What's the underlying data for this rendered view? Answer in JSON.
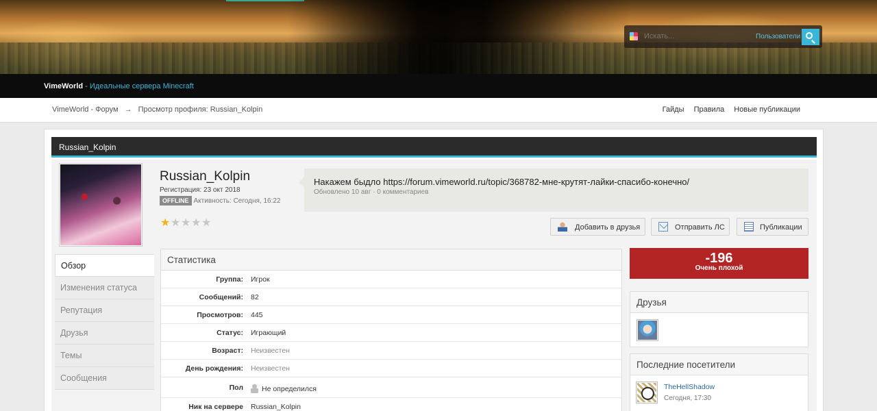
{
  "search": {
    "placeholder": "Искать...",
    "users_link": "Пользователи"
  },
  "brand": {
    "name": "VimeWorld",
    "separator": " - ",
    "tagline": "Идеальные сервера Minecraft"
  },
  "breadcrumb": {
    "home": "VimeWorld - Форум",
    "arrow": "→",
    "current": "Просмотр профиля: Russian_Kolpin"
  },
  "toplinks": [
    "Гайды",
    "Правила",
    "Новые публикации"
  ],
  "profile": {
    "header_name": "Russian_Kolpin",
    "name": "Russian_Kolpin",
    "registered": "Регистрация: 23 окт 2018",
    "online_badge": "OFFLINE",
    "activity": "Активность: Сегодня, 16:22",
    "rating_stars": 1,
    "rating_max": 5
  },
  "status_update": {
    "text": "Накажем быдло https://forum.vimeworld.ru/topic/368782-мне-крутят-лайки-спасибо-конечно/",
    "meta": "Обновлено 10 авг · 0 комментариев"
  },
  "actions": {
    "add_friend": "Добавить в друзья",
    "send_pm": "Отправить ЛС",
    "publications": "Публикации"
  },
  "sidenav": [
    "Обзор",
    "Изменения статуса",
    "Репутация",
    "Друзья",
    "Темы",
    "Сообщения"
  ],
  "stats": {
    "title": "Статистика",
    "rows": [
      {
        "k": "Группа:",
        "v": "Игрок"
      },
      {
        "k": "Сообщений:",
        "v": "82"
      },
      {
        "k": "Просмотров:",
        "v": "445"
      },
      {
        "k": "Статус:",
        "v": "Играющий"
      },
      {
        "k": "Возраст:",
        "v": "Неизвестен"
      },
      {
        "k": "День рождения:",
        "v": "Неизвестен"
      },
      {
        "k": "Пол",
        "v": "Не определился"
      },
      {
        "k": "Ник на сервере",
        "v": "Russian_Kolpin"
      }
    ]
  },
  "reputation": {
    "value": "-196",
    "label": "Очень плохой",
    "color": "#b32424"
  },
  "friends": {
    "title": "Друзья"
  },
  "visitors": {
    "title": "Последние посетители",
    "items": [
      {
        "name": "TheHellShadow",
        "time": "Сегодня, 17:30"
      }
    ]
  },
  "accent_color": "#3cb6d8"
}
